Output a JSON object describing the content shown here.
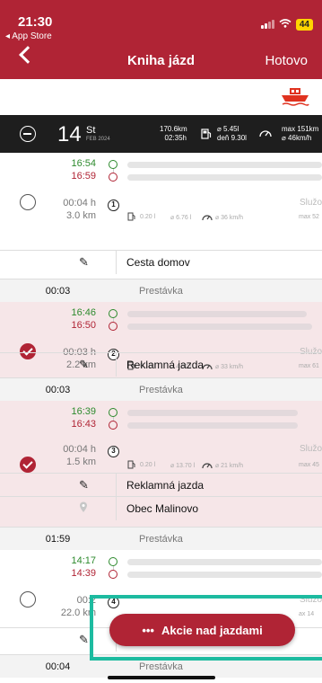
{
  "status": {
    "time": "21:30",
    "back_app": "◂ App Store",
    "battery": "44"
  },
  "nav": {
    "title": "Kniha jázd",
    "done": "Hotovo"
  },
  "day": {
    "num": "14",
    "weekday": "St",
    "month": "FEB 2024",
    "distance": "170.6km",
    "duration": "02:35h",
    "avg_cons": "⌀ 5.45l",
    "day_cons": "deň 9.30l",
    "max_speed": "max 151km",
    "avg_speed": "⌀ 46km/h"
  },
  "trips": [
    {
      "start": "16:54",
      "end": "16:59",
      "duration": "00:04 h",
      "km": "3.0 km",
      "number": "1",
      "category": "Služo",
      "fuel": "0.20 l",
      "fuel_avg": "⌀ 6.76 l",
      "speed_avg": "⌀ 36 km/h",
      "speed_max": "max 52",
      "note": "Cesta domov",
      "selected": false
    },
    {
      "start": "16:46",
      "end": "16:50",
      "duration": "00:03 h",
      "km": "2.2 km",
      "number": "2",
      "category": "Služo",
      "fuel": "0.10 l",
      "fuel_avg": "⌀ 4.57 l",
      "speed_avg": "⌀ 33 km/h",
      "speed_max": "max 61",
      "note": "Reklamná jazda",
      "selected": true
    },
    {
      "start": "16:39",
      "end": "16:43",
      "duration": "00:04 h",
      "km": "1.5 km",
      "number": "3",
      "category": "Služo",
      "fuel": "0.20 l",
      "fuel_avg": "⌀ 13.70 l",
      "speed_avg": "⌀ 21 km/h",
      "speed_max": "max 45",
      "note": "Reklamná jazda",
      "place": "Obec Malinovo",
      "selected": true
    },
    {
      "start": "14:17",
      "end": "14:39",
      "duration": "00:2",
      "km": "22.0 km",
      "number": "4",
      "category": "Služo",
      "speed_max": "ax 14",
      "selected": false
    }
  ],
  "breaks": [
    {
      "time": "00:03",
      "label": "Prestávka"
    },
    {
      "time": "00:03",
      "label": "Prestávka"
    },
    {
      "time": "01:59",
      "label": "Prestávka"
    },
    {
      "time": "00:04",
      "label": "Prestávka"
    }
  ],
  "action_button": {
    "label": "Akcie nad jazdami",
    "dots": "•••"
  },
  "colors": {
    "brand": "#b02435",
    "highlight": "#1dbba0",
    "start_green": "#2d8a2d"
  }
}
